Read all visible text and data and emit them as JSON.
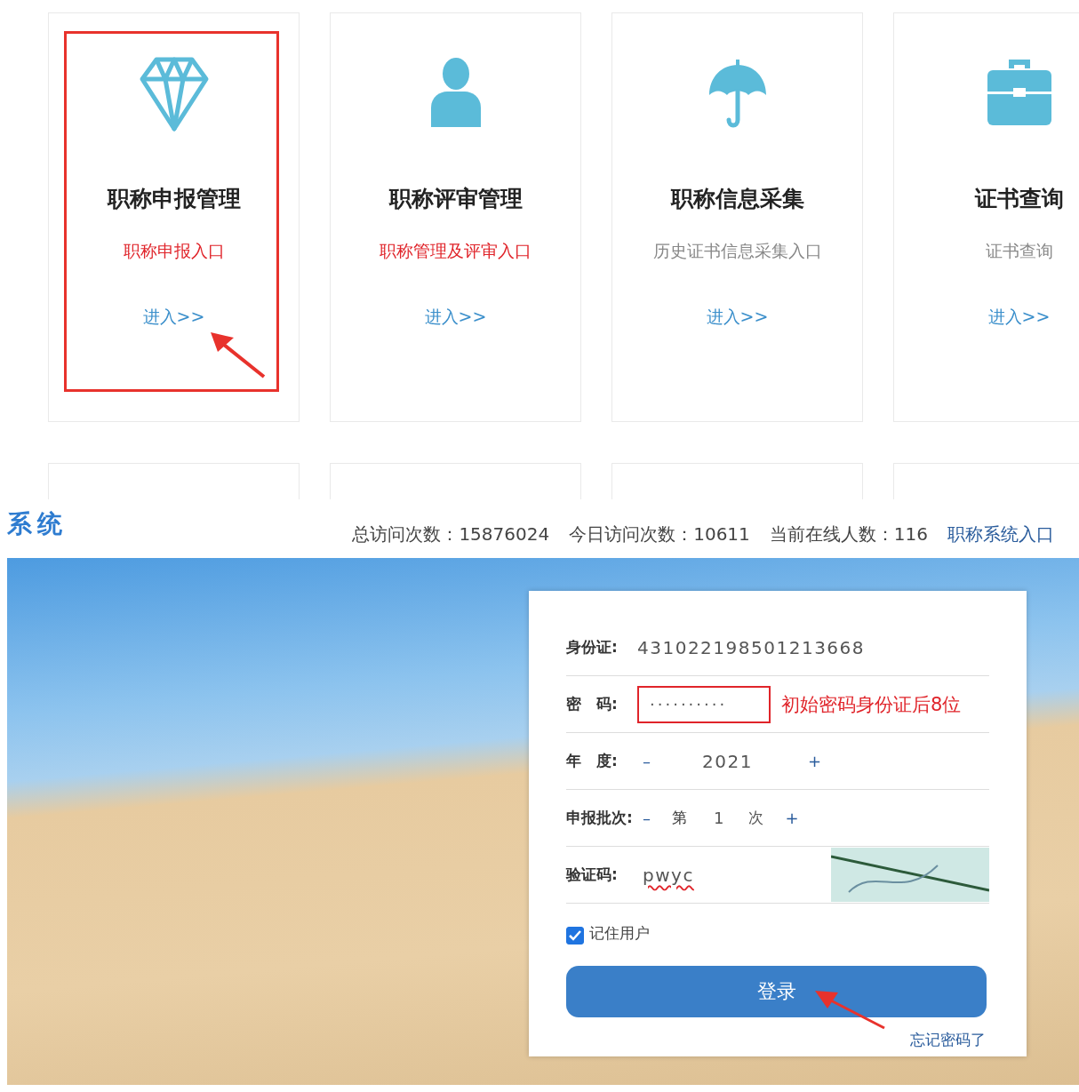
{
  "cards": [
    {
      "title": "职称申报管理",
      "subtitle": "职称申报入口",
      "subtitle_highlighted": true,
      "link": "进入>>",
      "marked": true
    },
    {
      "title": "职称评审管理",
      "subtitle": "职称管理及评审入口",
      "subtitle_highlighted": true,
      "link": "进入>>",
      "marked": false
    },
    {
      "title": "职称信息采集",
      "subtitle": "历史证书信息采集入口",
      "subtitle_highlighted": false,
      "link": "进入>>",
      "marked": false
    },
    {
      "title": "证书查询",
      "subtitle": "证书查询",
      "subtitle_highlighted": false,
      "link": "进入>>",
      "marked": false
    }
  ],
  "second_row_cards": [
    {
      "cut_off": true
    },
    {
      "cut_off": true
    },
    {
      "cut_off": true
    },
    {
      "cut_off": true
    }
  ],
  "header": {
    "logo": "系统",
    "stats": [
      "总访问次数：15876024",
      "今日访问次数：10611",
      "当前在线人数：116"
    ],
    "link": "职称系统入口"
  },
  "login": {
    "rows": [
      {
        "kind": "text",
        "label": "身份证:",
        "value": "431022198501213668"
      },
      {
        "kind": "password",
        "label": "密　码:",
        "value": "··········",
        "hint": "初始密码身份证后8位",
        "marked": true
      },
      {
        "kind": "stepper",
        "label": "年　度:",
        "minus": "–",
        "value": "2021",
        "plus": "+"
      },
      {
        "kind": "batch",
        "label": "申报批次:",
        "minus": "–",
        "prefix": "第",
        "value": "1",
        "suffix": "次",
        "plus": "+"
      },
      {
        "kind": "captcha",
        "label": "验证码:",
        "value": "pwyc",
        "misspelled": true
      }
    ],
    "remember": {
      "label": "记住用户",
      "checked": true
    },
    "button": {
      "label": "登录",
      "marked": true
    },
    "forgot": "忘记密码了"
  }
}
